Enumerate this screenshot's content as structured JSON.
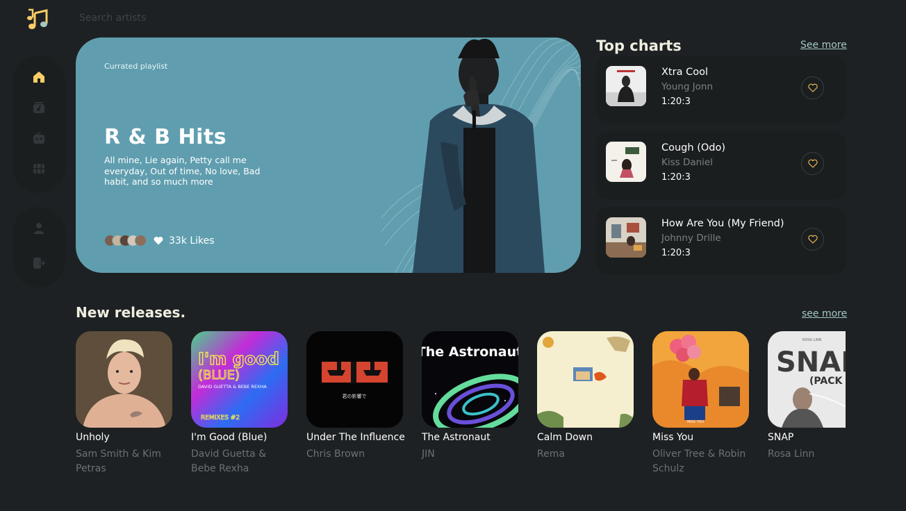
{
  "search": {
    "placeholder": "Search artists",
    "icon": "logo-music-icon"
  },
  "sidebar": {
    "primary": [
      {
        "name": "home",
        "icon": "home-icon",
        "active": true
      },
      {
        "name": "playlist",
        "icon": "playlist-icon",
        "active": false
      },
      {
        "name": "radio",
        "icon": "radio-icon",
        "active": false
      },
      {
        "name": "videos",
        "icon": "video-icon",
        "active": false
      }
    ],
    "secondary": [
      {
        "name": "profile",
        "icon": "profile-icon"
      },
      {
        "name": "logout",
        "icon": "logout-icon"
      }
    ]
  },
  "hero": {
    "kicker": "Currated playlist",
    "title": "R & B Hits",
    "description": "All mine, Lie again, Petty call me everyday, Out of time, No love, Bad habit, and so much more",
    "likes": "33k Likes"
  },
  "top_charts": {
    "title": "Top charts",
    "see_more": "See more",
    "items": [
      {
        "name": "Xtra Cool",
        "artist": "Young Jonn",
        "duration": "1:20:3"
      },
      {
        "name": "Cough (Odo)",
        "artist": "Kiss Daniel",
        "duration": "1:20:3"
      },
      {
        "name": "How Are You (My Friend)",
        "artist": "Johnny Drille",
        "duration": "1:20:3"
      }
    ]
  },
  "new_releases": {
    "title": "New releases.",
    "see_more": "see more",
    "items": [
      {
        "title": "Unholy",
        "artist": "Sam Smith & Kim Petras"
      },
      {
        "title": "I'm Good (Blue)",
        "artist": "David Guetta & Bebe Rexha",
        "cover_text": "I'm good",
        "cover_sub": "(BLUE)",
        "cover_credit": "DAVID GUETTA & BEBE REXHA",
        "cover_remix": "REMIXES #2"
      },
      {
        "title": "Under The Influence",
        "artist": "Chris Brown",
        "cover_text": "君の影響で"
      },
      {
        "title": "The Astronaut",
        "artist": "JIN",
        "cover_text": "The Astronaut"
      },
      {
        "title": "Calm Down",
        "artist": "Rema"
      },
      {
        "title": "Miss You",
        "artist": "Oliver Tree & Robin Schulz",
        "cover_text": "MISS YOU"
      },
      {
        "title": "SNAP",
        "artist": "Rosa Linn",
        "cover_text": "SNAP",
        "cover_sub": "(PACK",
        "cover_credit": "ROSA LINN"
      }
    ]
  },
  "colors": {
    "background": "#1d2123",
    "accent": "#facd66",
    "hero": "#609eaf",
    "card": "#1a1e1f",
    "muted": "#7c8183",
    "link": "#a4c7c6"
  }
}
